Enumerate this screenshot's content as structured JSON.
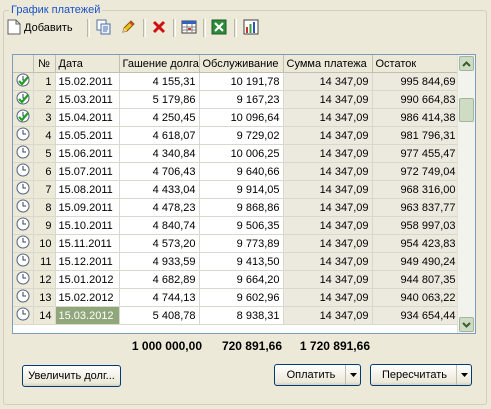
{
  "group_title": "График платежей",
  "toolbar": {
    "add_label": "Добавить",
    "icons": [
      "add-document-icon",
      "copy-icon",
      "edit-pencil-icon",
      "delete-icon",
      "table-icon",
      "excel-export-icon",
      "chart-icon"
    ]
  },
  "columns": [
    "№",
    "Дата",
    "Гашение долга",
    "Обслуживание",
    "Сумма платежа",
    "Остаток"
  ],
  "rows": [
    {
      "status": "paid",
      "no": "1",
      "date": "15.02.2011",
      "debt": "4 155,31",
      "service": "10 191,78",
      "payment": "14 347,09",
      "rest": "995 844,69"
    },
    {
      "status": "paid",
      "no": "2",
      "date": "15.03.2011",
      "debt": "5 179,86",
      "service": "9 167,23",
      "payment": "14 347,09",
      "rest": "990 664,83"
    },
    {
      "status": "paid",
      "no": "3",
      "date": "15.04.2011",
      "debt": "4 250,45",
      "service": "10 096,64",
      "payment": "14 347,09",
      "rest": "986 414,38"
    },
    {
      "status": "pending",
      "no": "4",
      "date": "15.05.2011",
      "debt": "4 618,07",
      "service": "9 729,02",
      "payment": "14 347,09",
      "rest": "981 796,31"
    },
    {
      "status": "pending",
      "no": "5",
      "date": "15.06.2011",
      "debt": "4 340,84",
      "service": "10 006,25",
      "payment": "14 347,09",
      "rest": "977 455,47"
    },
    {
      "status": "pending",
      "no": "6",
      "date": "15.07.2011",
      "debt": "4 706,43",
      "service": "9 640,66",
      "payment": "14 347,09",
      "rest": "972 749,04"
    },
    {
      "status": "pending",
      "no": "7",
      "date": "15.08.2011",
      "debt": "4 433,04",
      "service": "9 914,05",
      "payment": "14 347,09",
      "rest": "968 316,00"
    },
    {
      "status": "pending",
      "no": "8",
      "date": "15.09.2011",
      "debt": "4 478,23",
      "service": "9 868,86",
      "payment": "14 347,09",
      "rest": "963 837,77"
    },
    {
      "status": "pending",
      "no": "9",
      "date": "15.10.2011",
      "debt": "4 840,74",
      "service": "9 506,35",
      "payment": "14 347,09",
      "rest": "958 997,03"
    },
    {
      "status": "pending",
      "no": "10",
      "date": "15.11.2011",
      "debt": "4 573,20",
      "service": "9 773,89",
      "payment": "14 347,09",
      "rest": "954 423,83"
    },
    {
      "status": "pending",
      "no": "11",
      "date": "15.12.2011",
      "debt": "4 933,59",
      "service": "9 413,50",
      "payment": "14 347,09",
      "rest": "949 490,24"
    },
    {
      "status": "pending",
      "no": "12",
      "date": "15.01.2012",
      "debt": "4 682,89",
      "service": "9 664,20",
      "payment": "14 347,09",
      "rest": "944 807,35"
    },
    {
      "status": "pending",
      "no": "13",
      "date": "15.02.2012",
      "debt": "4 744,13",
      "service": "9 602,96",
      "payment": "14 347,09",
      "rest": "940 063,22"
    },
    {
      "status": "pending",
      "no": "14",
      "date": "15.03.2012",
      "debt": "5 408,78",
      "service": "8 938,31",
      "payment": "14 347,09",
      "rest": "934 654,44"
    }
  ],
  "selected_row": 13,
  "totals": {
    "debt": "1 000 000,00",
    "service": "720 891,66",
    "payment": "1 720 891,66"
  },
  "buttons": {
    "increase_debt": "Увеличить долг...",
    "pay": "Оплатить",
    "recalc": "Пересчитать"
  }
}
